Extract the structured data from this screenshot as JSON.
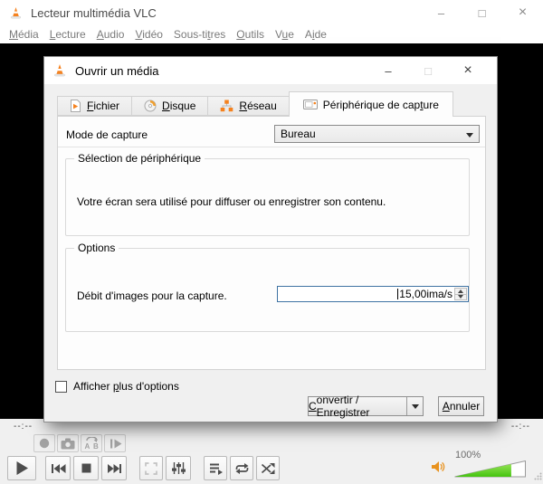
{
  "colors": {
    "accent_orange": "#f5821f",
    "volume_green": "#5bd125",
    "speaker_orange": "#e8921e",
    "focus_blue": "#3f73a3"
  },
  "window": {
    "title": "Lecteur multimédia VLC",
    "controls": {
      "minimize": "–",
      "maximize": "□",
      "close": "×"
    },
    "menu": [
      {
        "label": "Média",
        "u": 0
      },
      {
        "label": "Lecture",
        "u": 0
      },
      {
        "label": "Audio",
        "u": 0
      },
      {
        "label": "Vidéo",
        "u": 0
      },
      {
        "label": "Sous-titres",
        "u": 7
      },
      {
        "label": "Outils",
        "u": 0
      },
      {
        "label": "Vue",
        "u": 1
      },
      {
        "label": "Aide",
        "u": 1
      }
    ]
  },
  "dialog": {
    "title": "Ouvrir un média",
    "controls": {
      "minimize": "–",
      "maximize": "□",
      "close": "×"
    },
    "tabs": [
      {
        "label": "Fichier",
        "u": 0,
        "icon": "file-icon",
        "active": false
      },
      {
        "label": "Disque",
        "u": 0,
        "icon": "disc-icon",
        "active": false
      },
      {
        "label": "Réseau",
        "u": 0,
        "icon": "network-icon",
        "active": false
      },
      {
        "label": "Périphérique de capture",
        "u": 19,
        "icon": "capture-icon",
        "active": true
      }
    ],
    "capture_mode": {
      "label": "Mode de capture",
      "value": "Bureau"
    },
    "device_selection": {
      "title": "Sélection de périphérique",
      "message": "Votre écran sera utilisé pour diffuser ou enregistrer son contenu."
    },
    "options": {
      "title": "Options",
      "framerate_label": "Débit d'images pour la capture.",
      "framerate_value": "15,00ima/s"
    },
    "show_more_options": {
      "label": "Afficher plus d'options",
      "u": 9,
      "checked": false
    },
    "buttons": {
      "convert_save": {
        "label": "Convertir / Enregistrer",
        "u": 0
      },
      "cancel": {
        "label": "Annuler",
        "u": 0
      }
    }
  },
  "player": {
    "time_elapsed": "--:--",
    "time_total": "--:--",
    "advanced_controls": [
      "record-icon",
      "snapshot-icon",
      "ab-loop-icon",
      "frame-by-frame-icon"
    ],
    "main_controls": [
      "play-icon",
      "previous-icon",
      "stop-icon",
      "next-icon",
      "fullscreen-icon",
      "equalizer-icon",
      "playlist-icon",
      "loop-icon",
      "random-icon"
    ],
    "volume_label": "100%",
    "volume_percent": 80
  }
}
